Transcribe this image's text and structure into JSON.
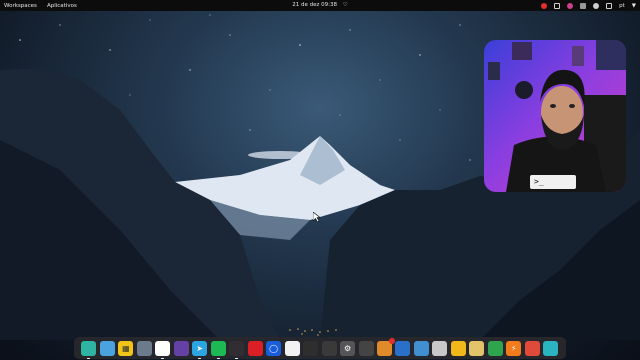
{
  "topbar": {
    "workspaces_label": "Workspaces",
    "apps_label": "Aplicativos",
    "clock": "21 de dez  09:38",
    "keyboard_layout": "pt"
  },
  "dock": {
    "items": [
      {
        "name": "files-manager",
        "color": "#2fb3a3"
      },
      {
        "name": "screenshot-tool",
        "color": "#4aa3df"
      },
      {
        "name": "app-grid",
        "color": "#f0c419"
      },
      {
        "name": "folder",
        "color": "#6b7b8c"
      },
      {
        "name": "chrome",
        "color": "#ffffff"
      },
      {
        "name": "twitch",
        "color": "#6441a5"
      },
      {
        "name": "telegram",
        "color": "#2ca5e0"
      },
      {
        "name": "spotify",
        "color": "#1db954"
      },
      {
        "name": "obs",
        "color": "#302e31"
      },
      {
        "name": "creative-cloud",
        "color": "#da1f26"
      },
      {
        "name": "bitwarden",
        "color": "#175ddc"
      },
      {
        "name": "text-editor",
        "color": "#f2f2f2"
      },
      {
        "name": "terminal",
        "color": "#2e2e2e"
      },
      {
        "name": "window-manager",
        "color": "#3a3a3a"
      },
      {
        "name": "settings",
        "color": "#555555"
      },
      {
        "name": "screen-capture",
        "color": "#444444"
      },
      {
        "name": "package-manager",
        "color": "#e08a2a"
      },
      {
        "name": "network",
        "color": "#2a6fc9"
      },
      {
        "name": "photo-viewer",
        "color": "#3f8fd1"
      },
      {
        "name": "app-store",
        "color": "#c8c8c8"
      },
      {
        "name": "sunflower",
        "color": "#f0b818"
      },
      {
        "name": "archive",
        "color": "#e4c46a"
      },
      {
        "name": "git-client",
        "color": "#2ea44f"
      },
      {
        "name": "bolt-app",
        "color": "#f27b1c"
      },
      {
        "name": "toolbox",
        "color": "#e04a3b"
      },
      {
        "name": "remote-desktop",
        "color": "#2bb3c0"
      }
    ]
  },
  "webcam": {
    "shirt_text": ">_"
  }
}
